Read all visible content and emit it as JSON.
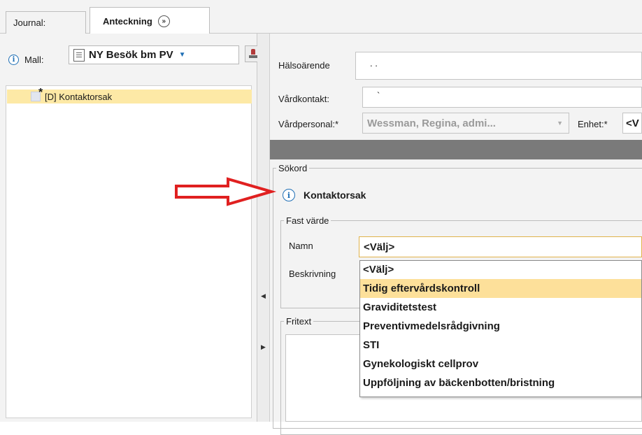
{
  "tabs": [
    {
      "label": "Journal:"
    },
    {
      "label": "Anteckning"
    }
  ],
  "left": {
    "mall_label": "Mall:",
    "mall_value": "NY Besök bm PV",
    "tree_item": "[D] Kontaktorsak"
  },
  "form": {
    "halsoarende_label": "Hälsoärende",
    "halsoarende_value": "  .  .",
    "vardkontakt_label": "Vårdkontakt:",
    "vardkontakt_value": "           `",
    "vardpersonal_label": "Vårdpersonal:*",
    "vardpersonal_value": "Wessman, Regina, admi...",
    "enhet_label": "Enhet:*",
    "enhet_value": "<V"
  },
  "sokord": {
    "legend": "Sökord",
    "title": "Kontaktorsak",
    "fast_varde_legend": "Fast värde",
    "namn_label": "Namn",
    "namn_value": "<Välj>",
    "beskrivning_label": "Beskrivning",
    "fritext_legend": "Fritext"
  },
  "dropdown": {
    "options": [
      "<Välj>",
      "Tidig eftervårdskontroll",
      "Graviditetstest",
      "Preventivmedelsrådgivning",
      "STI",
      "Gynekologiskt cellprov",
      "Uppföljning av bäckenbotten/bristning"
    ],
    "highlighted_index": 1
  },
  "colors": {
    "annotation_arrow": "#e02020",
    "highlight": "#fde09a",
    "info_blue": "#1f6fb5"
  }
}
